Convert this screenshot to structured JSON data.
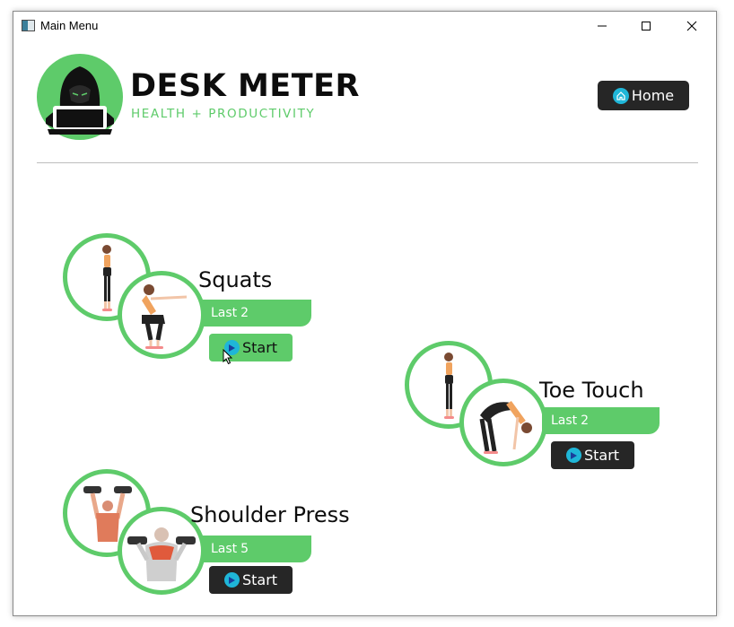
{
  "window": {
    "title": "Main Menu",
    "icon": "app-window-icon",
    "controls": [
      "minimize-icon",
      "maximize-icon",
      "close-icon"
    ]
  },
  "header": {
    "brand_name": "DESK METER",
    "tagline": "HEALTH + PRODUCTIVITY",
    "home_label": "Home",
    "home_icon": "home-icon"
  },
  "colors": {
    "accent_green": "#5ecb6a",
    "button_dark": "#262626",
    "icon_blue": "#1fb6d8",
    "text": "#0d0d0d"
  },
  "exercises": [
    {
      "name": "Squats",
      "last_label": "Last",
      "last_value": "2",
      "start_label": "Start",
      "start_hovered": true,
      "icon": "play-icon"
    },
    {
      "name": "Toe Touch",
      "last_label": "Last",
      "last_value": "2",
      "start_label": "Start",
      "start_hovered": false,
      "icon": "play-icon"
    },
    {
      "name": "Shoulder Press",
      "last_label": "Last",
      "last_value": "5",
      "start_label": "Start",
      "start_hovered": false,
      "icon": "play-icon"
    }
  ]
}
